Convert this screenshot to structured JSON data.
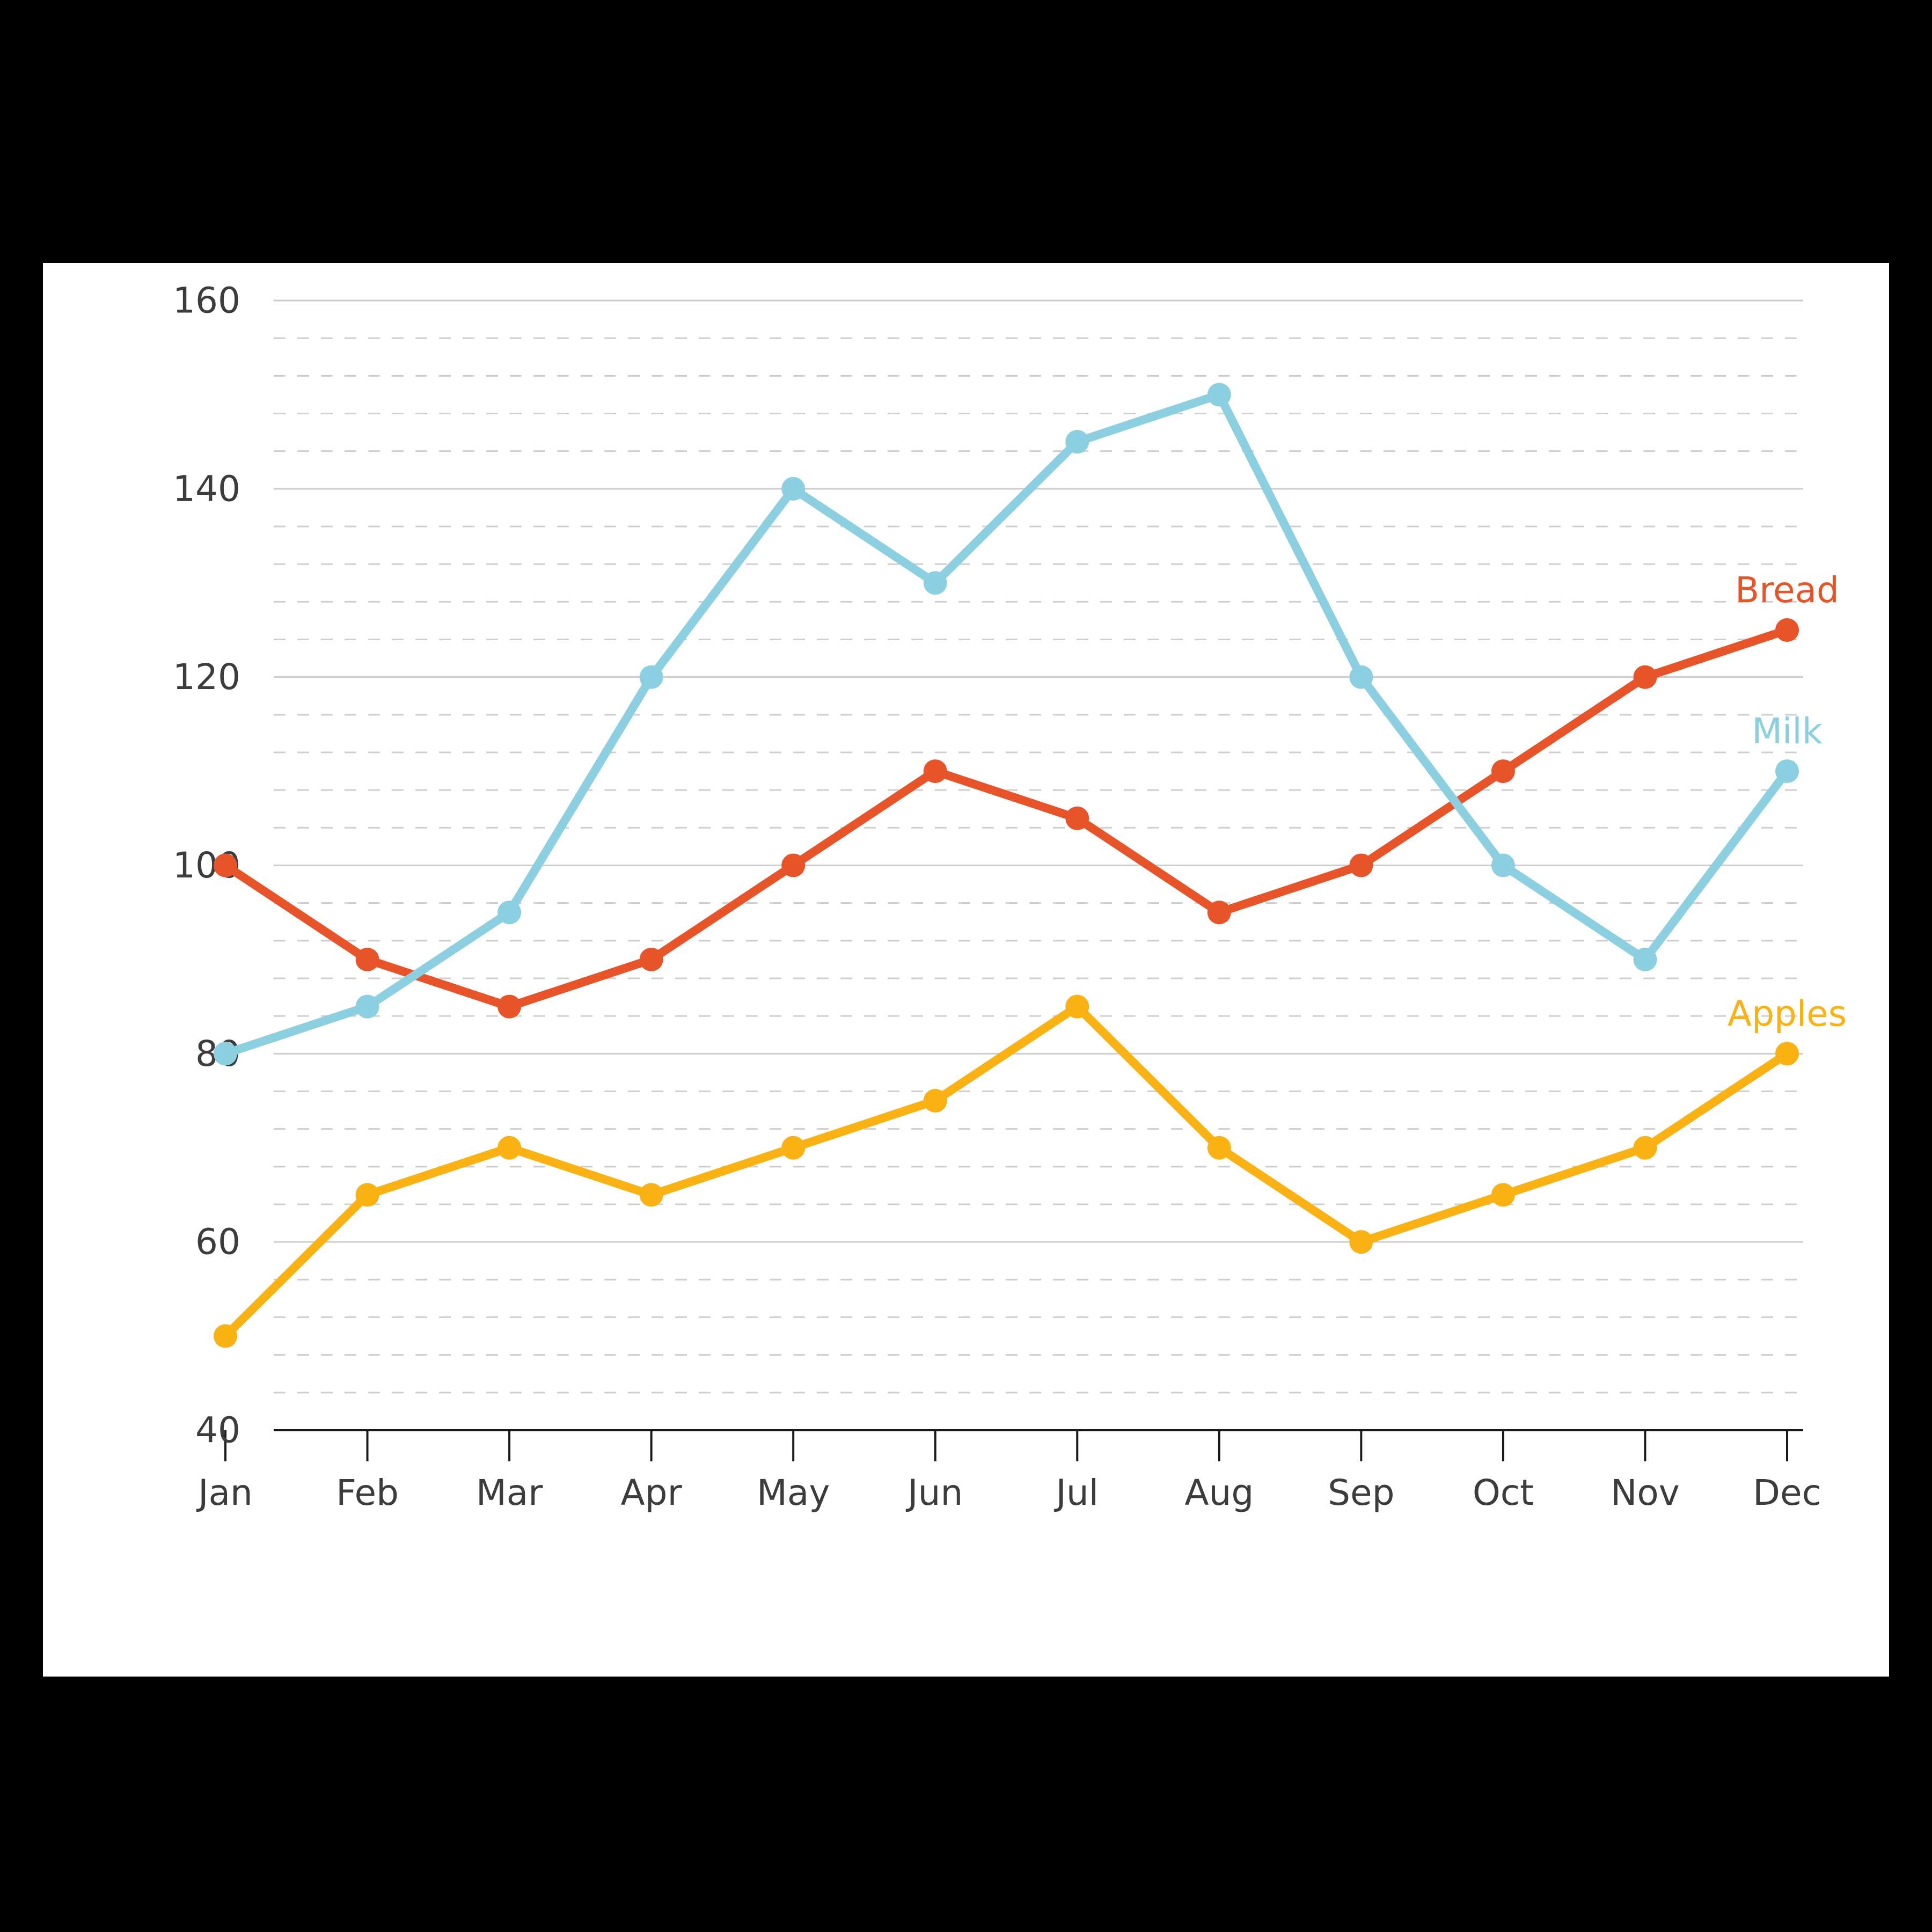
{
  "chart_data": {
    "type": "line",
    "title": "",
    "subtitle": "",
    "xlabel": "",
    "ylabel": "",
    "categories": [
      "Jan",
      "Feb",
      "Mar",
      "Apr",
      "May",
      "Jun",
      "Jul",
      "Aug",
      "Sep",
      "Oct",
      "Nov",
      "Dec"
    ],
    "ylim": [
      40,
      160
    ],
    "y_ticks": [
      40,
      60,
      80,
      100,
      120,
      140,
      160
    ],
    "y_tick_labels": [
      "40",
      "60",
      "80",
      "100",
      "120",
      "140",
      "160"
    ],
    "minor_tick_step": 4,
    "grid": "horizontal-major-solid-minor-dashed",
    "legend_position": "end-of-line-labels",
    "series": [
      {
        "name": "Bread",
        "color": "#E8542A",
        "values": [
          100,
          90,
          85,
          90,
          100,
          110,
          105,
          95,
          100,
          110,
          120,
          125
        ]
      },
      {
        "name": "Milk",
        "color": "#8BCFE0",
        "values": [
          80,
          85,
          95,
          120,
          140,
          130,
          145,
          150,
          120,
          100,
          90,
          110
        ]
      },
      {
        "name": "Apples",
        "color": "#F9B113",
        "values": [
          50,
          65,
          70,
          65,
          70,
          75,
          85,
          70,
          60,
          65,
          70,
          80
        ]
      }
    ]
  },
  "page": {
    "background_color": "#000000",
    "card_color": "#ffffff",
    "axis_label_color": "#3c3c3c",
    "major_gridline_color": "#cccccc",
    "minor_gridline_color": "#cfcfcf",
    "axis_line_color": "#1a1a1a"
  }
}
